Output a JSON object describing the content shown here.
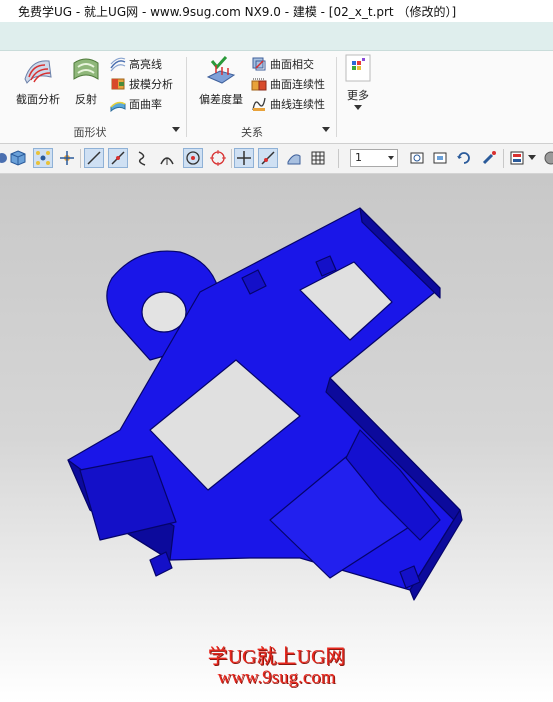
{
  "window": {
    "title": "免费学UG - 就上UG网 - www.9sug.com NX9.0 - 建模 - [02_x_t.prt （修改的）]"
  },
  "ribbon": {
    "shape_group": {
      "label": "面形状",
      "section_analysis": "截面分析",
      "reflection": "反射",
      "highlight_lines": "高亮线",
      "draft_analysis": "拔模分析",
      "surface_curvature": "面曲率"
    },
    "relations_group": {
      "label": "关系",
      "deviation_gauge": "偏差度量",
      "face_intersect": "曲面相交",
      "face_continuity": "曲面连续性",
      "curve_continuity": "曲线连续性"
    },
    "more": {
      "label": "更多"
    }
  },
  "toolbar": {
    "zoom_value": "1"
  },
  "model": {
    "color": "#1a16e8",
    "shade": "#0c0a9c"
  },
  "watermark": {
    "line1": "学UG就上UG网",
    "line2": "www.9sug.com"
  }
}
